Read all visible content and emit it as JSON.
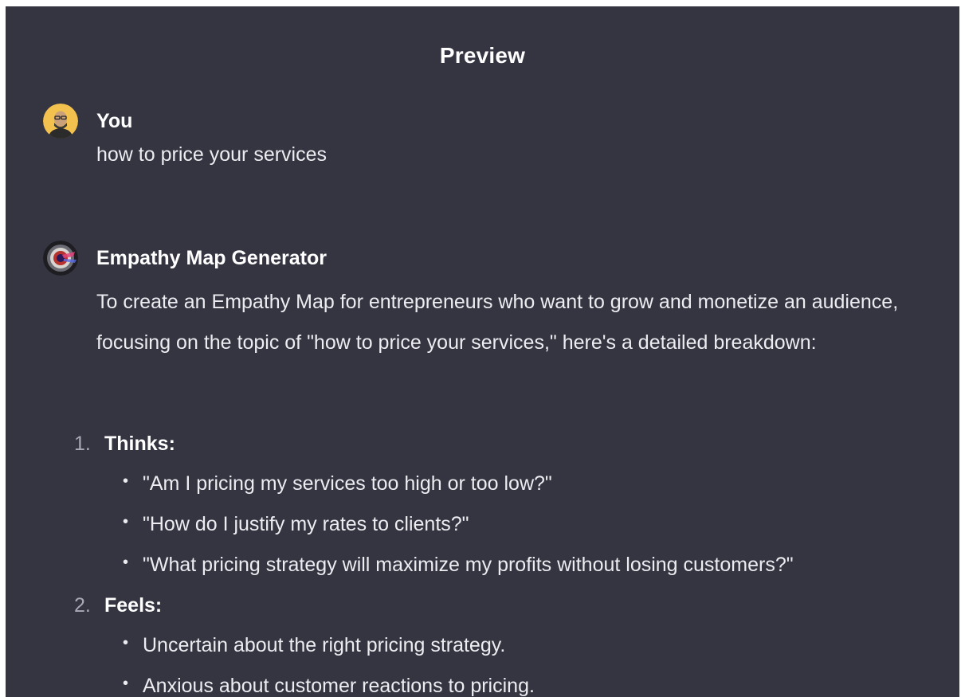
{
  "header": {
    "title": "Preview"
  },
  "user_message": {
    "author": "You",
    "text": "how to price your services",
    "avatar_icon": "user-avatar"
  },
  "bot_message": {
    "author": "Empathy Map Generator",
    "avatar_icon": "gpt-avatar",
    "intro": "To create an Empathy Map for entrepreneurs who want to grow and monetize an audience, focusing on the topic of \"how to price your services,\" here's a detailed breakdown:",
    "sections": [
      {
        "number": "1.",
        "title": "Thinks:",
        "bullets": [
          "\"Am I pricing my services too high or too low?\"",
          "\"How do I justify my rates to clients?\"",
          "\"What pricing strategy will maximize my profits without losing customers?\""
        ]
      },
      {
        "number": "2.",
        "title": "Feels:",
        "bullets": [
          "Uncertain about the right pricing strategy.",
          "Anxious about customer reactions to pricing."
        ]
      }
    ]
  },
  "colors": {
    "background": "#343541",
    "text": "#ececf1",
    "heading": "#ffffff",
    "list_number": "#a9a9b8"
  }
}
